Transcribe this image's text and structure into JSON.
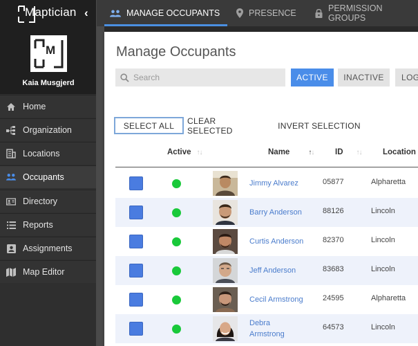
{
  "brand": {
    "name": "Maptician",
    "collapse_icon": "chevron-left-icon"
  },
  "profile": {
    "name": "Kaia Musgjerd"
  },
  "sidebar": {
    "items": [
      {
        "label": "Home",
        "icon": "home-icon"
      },
      {
        "label": "Organization",
        "icon": "org-chart-icon"
      },
      {
        "label": "Locations",
        "icon": "building-icon"
      },
      {
        "label": "Occupants",
        "icon": "people-icon",
        "active": true
      },
      {
        "label": "Directory",
        "icon": "id-card-icon"
      },
      {
        "label": "Reports",
        "icon": "list-icon"
      },
      {
        "label": "Assignments",
        "icon": "assignment-icon"
      },
      {
        "label": "Map Editor",
        "icon": "map-icon"
      }
    ]
  },
  "topnav": {
    "tabs": [
      {
        "label": "MANAGE OCCUPANTS",
        "icon": "people-icon",
        "active": true
      },
      {
        "label": "PRESENCE",
        "icon": "location-pin-icon"
      },
      {
        "label": "PERMISSION GROUPS",
        "icon": "lock-icon"
      }
    ]
  },
  "main": {
    "title": "Manage Occupants",
    "search": {
      "placeholder": "Search",
      "value": ""
    },
    "filters": {
      "active": "ACTIVE",
      "inactive": "INACTIVE",
      "log": "LOG"
    },
    "selection": {
      "select_all": "SELECT ALL",
      "clear_selected": "CLEAR SELECTED",
      "invert_selection": "INVERT SELECTION"
    }
  },
  "table": {
    "columns": {
      "active": "Active",
      "name": "Name",
      "id": "ID",
      "location": "Location"
    },
    "rows": [
      {
        "name": "Jimmy Alvarez",
        "id": "05877",
        "location": "Alpharetta",
        "active": true
      },
      {
        "name": "Barry Anderson",
        "id": "88126",
        "location": "Lincoln",
        "active": true
      },
      {
        "name": "Curtis Anderson",
        "id": "82370",
        "location": "Lincoln",
        "active": true
      },
      {
        "name": "Jeff Anderson",
        "id": "83683",
        "location": "Lincoln",
        "active": true
      },
      {
        "name": "Cecil Armstrong",
        "id": "24595",
        "location": "Alpharetta",
        "active": true
      },
      {
        "name": "Debra Armstrong",
        "id": "64573",
        "location": "Lincoln",
        "active": true
      }
    ]
  },
  "colors": {
    "accent": "#4a8de9",
    "status_active": "#19c93a",
    "link": "#4a7ccc",
    "sidebar_bg": "#2f2f2f"
  }
}
